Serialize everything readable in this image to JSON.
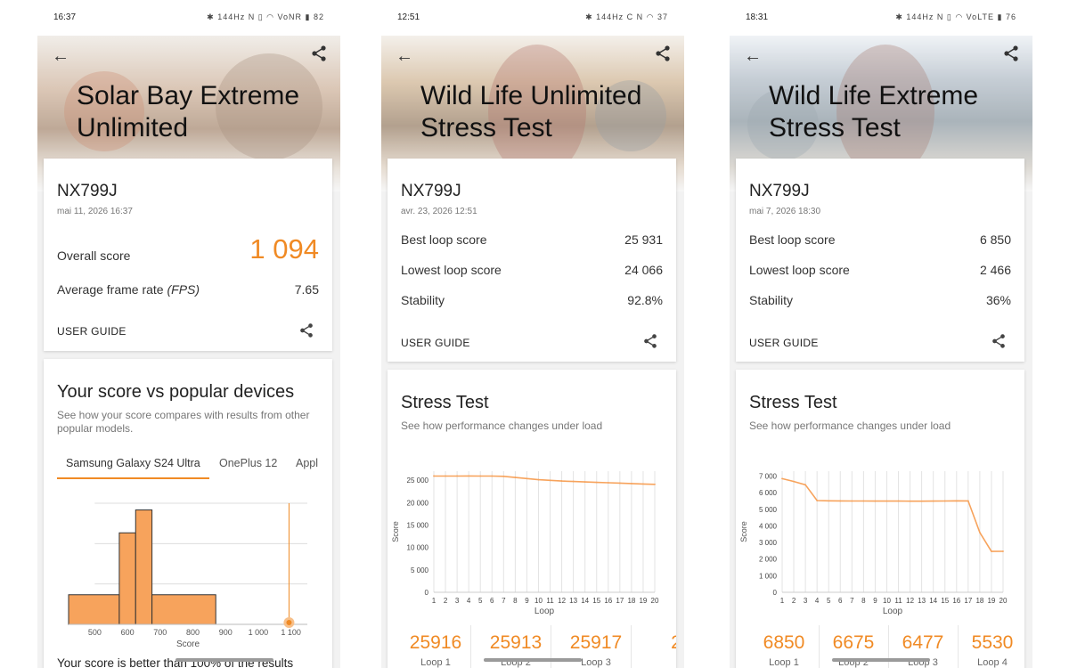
{
  "colors": {
    "accent": "#f08a24",
    "chart_fill": "#f7a35c"
  },
  "panels": [
    {
      "status_time": "16:37",
      "status_icons": "✱ 144Hz   N ▯ ◠ VoNR ▮ 82",
      "title": "Solar Bay Extreme\nUnlimited",
      "device": "NX799J",
      "date": "mai 11, 2026 16:37",
      "overall_label": "Overall score",
      "overall_value": "1 094",
      "fps_label": "Average frame rate",
      "fps_unit": "(FPS)",
      "fps_value": "7.65",
      "guide": "USER GUIDE",
      "compare_title": "Your score vs popular devices",
      "compare_sub": "See how your score compares with results from other popular models.",
      "tabs": [
        "Samsung Galaxy S24 Ultra",
        "OnePlus 12",
        "Appl"
      ],
      "bottom_text": "Your score is better than 100% of the results"
    },
    {
      "status_time": "12:51",
      "status_icons": "✱ 144Hz  C     N ◠ 37",
      "title": "Wild Life Unlimited\nStress Test",
      "device": "NX799J",
      "date": "avr. 23, 2026 12:51",
      "rows": [
        {
          "label": "Best loop score",
          "value": "25 931"
        },
        {
          "label": "Lowest loop score",
          "value": "24 066"
        },
        {
          "label": "Stability",
          "value": "92.8%"
        }
      ],
      "guide": "USER GUIDE",
      "stress_title": "Stress Test",
      "stress_sub": "See how performance changes under load",
      "loops": [
        {
          "score": "25916",
          "label": "Loop 1"
        },
        {
          "score": "25913",
          "label": "Loop 2"
        },
        {
          "score": "25917",
          "label": "Loop 3"
        },
        {
          "score": "2",
          "label": ""
        }
      ]
    },
    {
      "status_time": "18:31",
      "status_icons": "✱ 144Hz    N ▯ ◠ VoLTE ▮ 76",
      "title": "Wild Life Extreme\nStress Test",
      "device": "NX799J",
      "date": "mai 7, 2026 18:30",
      "rows": [
        {
          "label": "Best loop score",
          "value": "6 850"
        },
        {
          "label": "Lowest loop score",
          "value": "2 466"
        },
        {
          "label": "Stability",
          "value": "36%"
        }
      ],
      "guide": "USER GUIDE",
      "stress_title": "Stress Test",
      "stress_sub": "See how performance changes under load",
      "loops": [
        {
          "score": "6850",
          "label": "Loop 1"
        },
        {
          "score": "6675",
          "label": "Loop 2"
        },
        {
          "score": "6477",
          "label": "Loop 3"
        },
        {
          "score": "5530",
          "label": "Loop 4"
        }
      ]
    }
  ],
  "chart_data": [
    {
      "type": "histogram",
      "title": "",
      "xlabel": "Score",
      "ylabel": "",
      "x_ticks": [
        500,
        600,
        700,
        800,
        900,
        1000,
        1100
      ],
      "x_tick_labels": [
        "500",
        "600",
        "700",
        "800",
        "900",
        "1 000",
        "1 100"
      ],
      "xlim": [
        420,
        1150
      ],
      "bins": [
        {
          "x0": 420,
          "x1": 575,
          "height": 0.22
        },
        {
          "x0": 575,
          "x1": 625,
          "height": 0.68
        },
        {
          "x0": 625,
          "x1": 675,
          "height": 0.85
        },
        {
          "x0": 675,
          "x1": 870,
          "height": 0.22
        }
      ],
      "marker": 1094
    },
    {
      "type": "line",
      "xlabel": "Loop",
      "ylabel": "Score",
      "ylim": [
        0,
        27000
      ],
      "y_ticks": [
        0,
        5000,
        10000,
        15000,
        20000,
        25000
      ],
      "y_tick_labels": [
        "0",
        "5 000",
        "10 000",
        "15 000",
        "20 000",
        "25 000"
      ],
      "x": [
        1,
        2,
        3,
        4,
        5,
        6,
        7,
        8,
        9,
        10,
        11,
        12,
        13,
        14,
        15,
        16,
        17,
        18,
        19,
        20
      ],
      "x_tick_labels": [
        "1",
        "2",
        "3",
        "4",
        "5",
        "6",
        "7",
        "8",
        "9",
        "10",
        "11",
        "12",
        "13",
        "14",
        "15",
        "16",
        "17",
        "18",
        "19",
        "20"
      ],
      "values": [
        25916,
        25913,
        25917,
        25931,
        25910,
        25900,
        25850,
        25600,
        25350,
        25100,
        24950,
        24800,
        24700,
        24600,
        24500,
        24420,
        24330,
        24250,
        24150,
        24066
      ]
    },
    {
      "type": "line",
      "xlabel": "Loop",
      "ylabel": "Score",
      "ylim": [
        0,
        7300
      ],
      "y_ticks": [
        0,
        1000,
        2000,
        3000,
        4000,
        5000,
        6000,
        7000
      ],
      "y_tick_labels": [
        "0",
        "1 000",
        "2 000",
        "3 000",
        "4 000",
        "5 000",
        "6 000",
        "7 000"
      ],
      "x": [
        1,
        2,
        3,
        4,
        5,
        6,
        7,
        8,
        9,
        10,
        11,
        12,
        13,
        14,
        15,
        16,
        17,
        18,
        19,
        20
      ],
      "x_tick_labels": [
        "1",
        "2",
        "3",
        "4",
        "5",
        "6",
        "7",
        "8",
        "9",
        "10",
        "11",
        "12",
        "13",
        "14",
        "15",
        "16",
        "17",
        "18",
        "19",
        "20"
      ],
      "values": [
        6850,
        6675,
        6477,
        5530,
        5510,
        5505,
        5500,
        5500,
        5495,
        5495,
        5500,
        5490,
        5490,
        5495,
        5500,
        5510,
        5505,
        3600,
        2466,
        2470
      ]
    }
  ]
}
